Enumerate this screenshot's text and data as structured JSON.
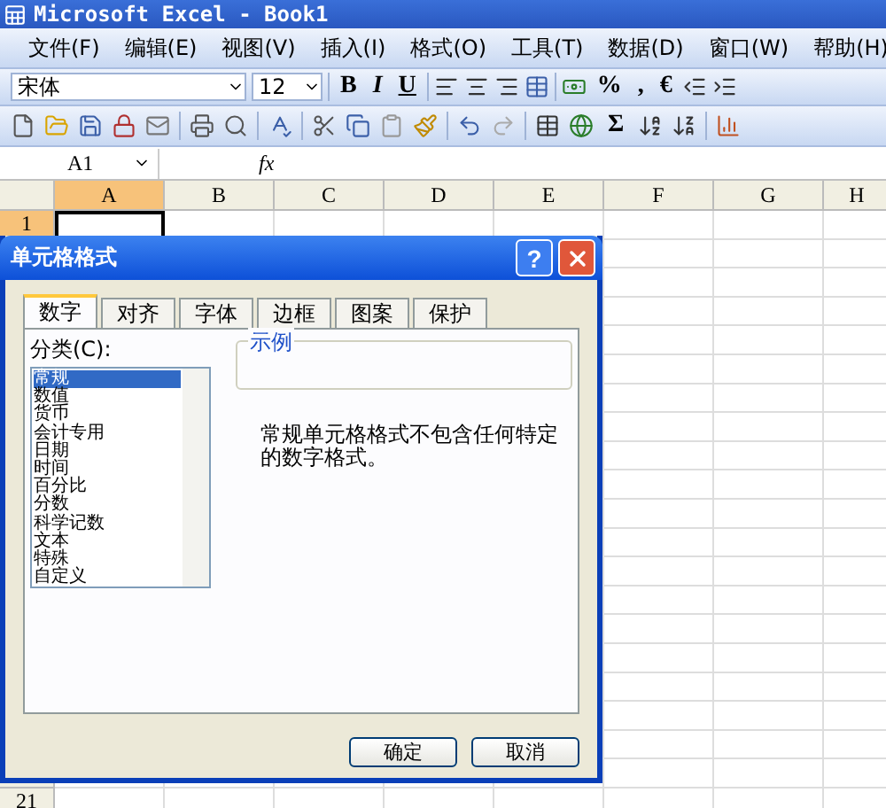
{
  "window": {
    "title": "Microsoft Excel - Book1"
  },
  "menu": [
    "文件(F)",
    "编辑(E)",
    "视图(V)",
    "插入(I)",
    "格式(O)",
    "工具(T)",
    "数据(D)",
    "窗口(W)",
    "帮助(H)"
  ],
  "format_toolbar": {
    "font": "宋体",
    "size": "12",
    "styles": [
      "B",
      "I",
      "U"
    ],
    "symbols": [
      "%",
      ",",
      "€"
    ]
  },
  "standard_toolbar": {
    "sum": "Σ"
  },
  "formula_bar": {
    "name_box": "A1",
    "fx": "fx"
  },
  "sheet": {
    "columns": [
      {
        "label": "A",
        "selected": true
      },
      {
        "label": "B",
        "selected": false
      },
      {
        "label": "C",
        "selected": false
      },
      {
        "label": "D",
        "selected": false
      },
      {
        "label": "E",
        "selected": false
      },
      {
        "label": "F",
        "selected": false
      },
      {
        "label": "G",
        "selected": false
      },
      {
        "label": "H",
        "selected": false
      }
    ],
    "rows": [
      {
        "label": "1",
        "selected": true
      },
      {
        "label": "21",
        "selected": false
      }
    ]
  },
  "dialog": {
    "title": "单元格格式",
    "help": "?",
    "tabs": [
      {
        "label": "数字",
        "selected": true
      },
      {
        "label": "对齐",
        "selected": false
      },
      {
        "label": "字体",
        "selected": false
      },
      {
        "label": "边框",
        "selected": false
      },
      {
        "label": "图案",
        "selected": false
      },
      {
        "label": "保护",
        "selected": false
      }
    ],
    "category_label": "分类(C):",
    "categories": [
      {
        "label": "常规",
        "selected": true
      },
      {
        "label": "数值",
        "selected": false
      },
      {
        "label": "货币",
        "selected": false
      },
      {
        "label": "会计专用",
        "selected": false
      },
      {
        "label": "日期",
        "selected": false
      },
      {
        "label": "时间",
        "selected": false
      },
      {
        "label": "百分比",
        "selected": false
      },
      {
        "label": "分数",
        "selected": false
      },
      {
        "label": "科学记数",
        "selected": false
      },
      {
        "label": "文本",
        "selected": false
      },
      {
        "label": "特殊",
        "selected": false
      },
      {
        "label": "自定义",
        "selected": false
      }
    ],
    "sample_label": "示例",
    "description": "常规单元格格式不包含任何特定的数字格式。",
    "buttons": [
      "确定",
      "取消"
    ]
  }
}
